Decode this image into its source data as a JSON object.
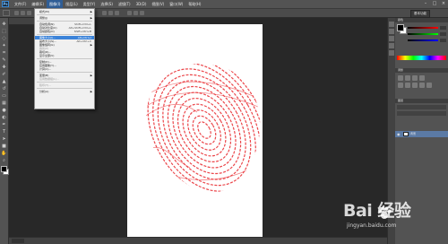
{
  "menubar": {
    "logo": "Ps",
    "items": [
      "文件(F)",
      "编辑(E)",
      "图像(I)",
      "图层(L)",
      "类型(Y)",
      "选择(S)",
      "滤镜(T)",
      "3D(D)",
      "视图(V)",
      "窗口(W)",
      "帮助(H)"
    ],
    "active_index": 2
  },
  "options": {
    "workspace": "基本功能"
  },
  "dropdown": {
    "items": [
      {
        "label": "模式(M)",
        "shortcut": "",
        "submenu": true,
        "highlighted": false,
        "disabled": false
      },
      {
        "separator": true
      },
      {
        "label": "调整(J)",
        "shortcut": "",
        "submenu": true,
        "highlighted": false,
        "disabled": false
      },
      {
        "separator": true
      },
      {
        "label": "自动色调(N)",
        "shortcut": "Shift+Ctrl+L",
        "submenu": false,
        "highlighted": false,
        "disabled": false
      },
      {
        "label": "自动对比度(U)",
        "shortcut": "Alt+Shift+Ctrl+L",
        "submenu": false,
        "highlighted": false,
        "disabled": false
      },
      {
        "label": "自动颜色(O)",
        "shortcut": "Shift+Ctrl+B",
        "submenu": false,
        "highlighted": false,
        "disabled": false
      },
      {
        "separator": true
      },
      {
        "label": "图像大小(I)...",
        "shortcut": "Alt+Ctrl+I",
        "submenu": false,
        "highlighted": true,
        "disabled": false
      },
      {
        "label": "画布大小(S)...",
        "shortcut": "Alt+Ctrl+C",
        "submenu": false,
        "highlighted": false,
        "disabled": false
      },
      {
        "label": "图像旋转(G)",
        "shortcut": "",
        "submenu": true,
        "highlighted": false,
        "disabled": false
      },
      {
        "label": "裁剪(P)",
        "shortcut": "",
        "submenu": false,
        "highlighted": false,
        "disabled": true
      },
      {
        "label": "裁切(R)...",
        "shortcut": "",
        "submenu": false,
        "highlighted": false,
        "disabled": false
      },
      {
        "label": "显示全部(V)",
        "shortcut": "",
        "submenu": false,
        "highlighted": false,
        "disabled": false
      },
      {
        "separator": true
      },
      {
        "label": "复制(D)...",
        "shortcut": "",
        "submenu": false,
        "highlighted": false,
        "disabled": false
      },
      {
        "label": "应用图像(Y)...",
        "shortcut": "",
        "submenu": false,
        "highlighted": false,
        "disabled": false
      },
      {
        "label": "计算(C)...",
        "shortcut": "",
        "submenu": false,
        "highlighted": false,
        "disabled": false
      },
      {
        "separator": true
      },
      {
        "label": "变量(B)",
        "shortcut": "",
        "submenu": true,
        "highlighted": false,
        "disabled": false
      },
      {
        "label": "应用数据组(L)...",
        "shortcut": "",
        "submenu": false,
        "highlighted": false,
        "disabled": true
      },
      {
        "separator": true
      },
      {
        "label": "陷印(T)...",
        "shortcut": "",
        "submenu": false,
        "highlighted": false,
        "disabled": true
      },
      {
        "separator": true
      },
      {
        "label": "分析(A)",
        "shortcut": "",
        "submenu": true,
        "highlighted": false,
        "disabled": false
      }
    ]
  },
  "panels": {
    "color_tab": "颜色",
    "adjust_tab": "调整",
    "layers_tab": "图层",
    "layer_name": "背景"
  },
  "status": {
    "zoom": "33.33%"
  },
  "watermark": {
    "brand": "Bai 经验",
    "url": "jingyan.baidu.com"
  },
  "colors": {
    "accent": "#3b83d9",
    "fingerprint": "#e8262b",
    "canvas_bg": "#282828",
    "panel_bg": "#535353"
  }
}
